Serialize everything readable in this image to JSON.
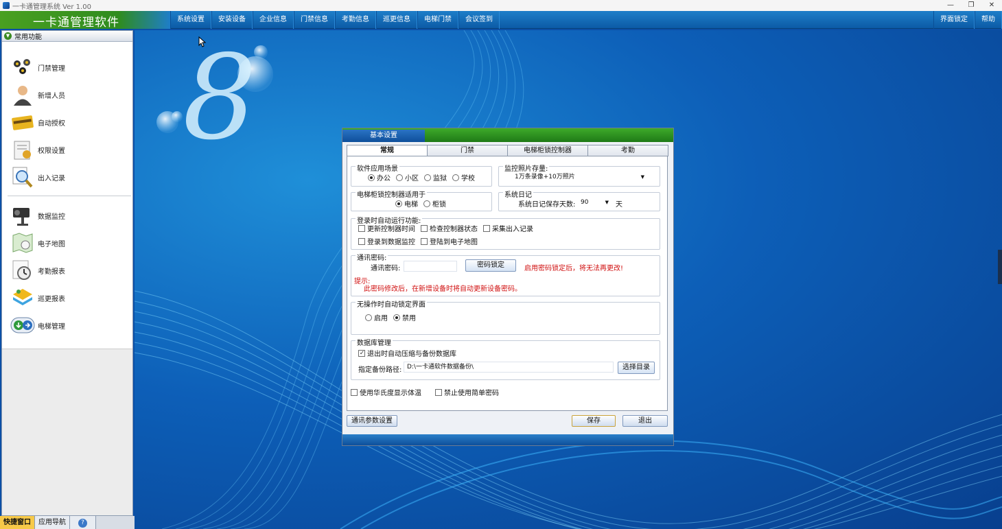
{
  "window": {
    "title": "一卡通管理系统  Ver 1.00",
    "controls": [
      "—",
      "❐",
      "✕"
    ]
  },
  "header": {
    "logo": "一卡通管理软件",
    "menu": [
      "系统设置",
      "安装设备",
      "企业信息",
      "门禁信息",
      "考勤信息",
      "巡更信息",
      "电梯门禁",
      "会议签到"
    ],
    "right_menu": [
      "界面锁定",
      "帮助"
    ]
  },
  "sidebar": {
    "header": "常用功能",
    "items": [
      {
        "label": "门禁管理",
        "icon": "door-access-icon"
      },
      {
        "label": "新增人员",
        "icon": "person-icon"
      },
      {
        "label": "自动授权",
        "icon": "card-icon"
      },
      {
        "label": "权限设置",
        "icon": "permission-icon"
      },
      {
        "label": "出入记录",
        "icon": "magnifier-icon"
      },
      {
        "label": "数据监控",
        "icon": "camera-icon"
      },
      {
        "label": "电子地图",
        "icon": "map-icon"
      },
      {
        "label": "考勤报表",
        "icon": "clock-icon"
      },
      {
        "label": "巡更报表",
        "icon": "patrol-icon"
      },
      {
        "label": "电梯管理",
        "icon": "elevator-icon"
      }
    ],
    "bottom_tabs": [
      "快捷窗口",
      "应用导航"
    ]
  },
  "desktop": {
    "logo_digit": "8"
  },
  "dialog": {
    "title": "基本设置",
    "tabs": [
      "常规",
      "门禁",
      "电梯柜锁控制器",
      "考勤"
    ],
    "active_tab": "常规",
    "scene": {
      "title": "软件应用场景",
      "options": [
        "办公",
        "小区",
        "监狱",
        "学校"
      ],
      "selected": "办公"
    },
    "photo": {
      "title": "监控照片存量:",
      "value": "1万条录像+10万照片"
    },
    "elevator": {
      "title": "电梯柜锁控制器适用于",
      "options": [
        "电梯",
        "柜锁"
      ],
      "selected": "电梯"
    },
    "syslog": {
      "title": "系统日记",
      "label": "系统日记保存天数:",
      "value": "90",
      "unit": "天"
    },
    "autorun": {
      "title": "登录时自动运行功能:",
      "options": [
        "更新控制器时间",
        "检查控制器状态",
        "采集出入记录",
        "登录到数据监控",
        "登陆到电子地图"
      ]
    },
    "comm": {
      "title": "通讯密码:",
      "label": "通讯密码:",
      "value": "",
      "lock_button": "密码锁定",
      "lock_warning": "启用密码锁定后，将无法再更改!",
      "hint_label": "提示:",
      "hint_text": "此密码修改后，在新增设备时将自动更新设备密码。"
    },
    "idle_lock": {
      "title": "无操作时自动锁定界面",
      "options": [
        "启用",
        "禁用"
      ],
      "selected": "禁用"
    },
    "db": {
      "title": "数据库管理",
      "compress_label": "退出时自动压缩与备份数据库",
      "compress_checked": true,
      "path_label": "指定备份路径:",
      "path_value": "D:\\一卡通软件数据备份\\",
      "browse_button": "选择目录"
    },
    "fahrenheit_label": "使用华氏度显示体温",
    "simple_pwd_label": "禁止使用简单密码",
    "buttons": {
      "comm_params": "通讯参数设置",
      "save": "保存",
      "exit": "退出"
    }
  }
}
